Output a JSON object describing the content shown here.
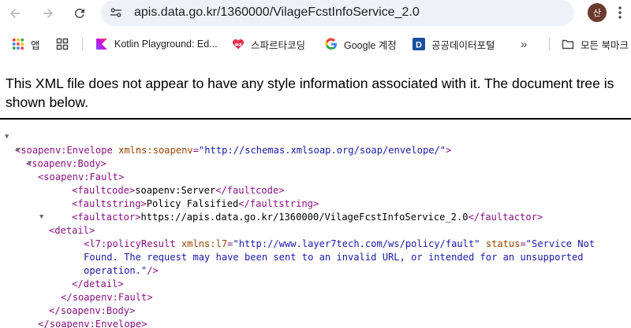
{
  "toolbar": {
    "url": "apis.data.go.kr/1360000/VilageFcstInfoService_2.0",
    "avatar_letter": "산"
  },
  "bookmarks": [
    {
      "label": "앱",
      "icon": "apps-grid-icon"
    },
    {
      "label": "",
      "icon": "tab-groups-icon"
    },
    {
      "label": "Kotlin Playground: Ed...",
      "icon": "kotlin-icon"
    },
    {
      "label": "스파르타코딩",
      "icon": "sparta-heart-icon"
    },
    {
      "label": "Google 계정",
      "icon": "google-icon"
    },
    {
      "label": "공공데이터포털",
      "icon": "data-portal-icon"
    },
    {
      "label": "모든 북마크",
      "icon": "folder-icon"
    }
  ],
  "notice": "This XML file does not appear to have any style information associated with it. The document tree is shown below.",
  "xml": {
    "envelope_tag": "soapenv:Envelope",
    "envelope_attr_name": "xmlns:soapenv",
    "envelope_attr_value": "\"http://schemas.xmlsoap.org/soap/envelope/\"",
    "body_tag": "soapenv:Body",
    "fault_tag": "soapenv:Fault",
    "faultcode_tag": "faultcode",
    "faultcode_value": "soapenv:Server",
    "faultstring_tag": "faultstring",
    "faultstring_value": "Policy Falsified",
    "faultactor_tag": "faultactor",
    "faultactor_value": "https://apis.data.go.kr/1360000/VilageFcstInfoService_2.0",
    "detail_tag": "detail",
    "policy_tag": "l7:policyResult",
    "policy_ns_name": "xmlns:l7",
    "policy_ns_value": "\"http://www.layer7tech.com/ws/policy/fault\"",
    "status_name": "status",
    "status_value_1": "\"Service Not",
    "status_value_2": "Found. The request may have been sent to an invalid URL, or intended for an unsupported",
    "status_value_3": "operation.\""
  }
}
